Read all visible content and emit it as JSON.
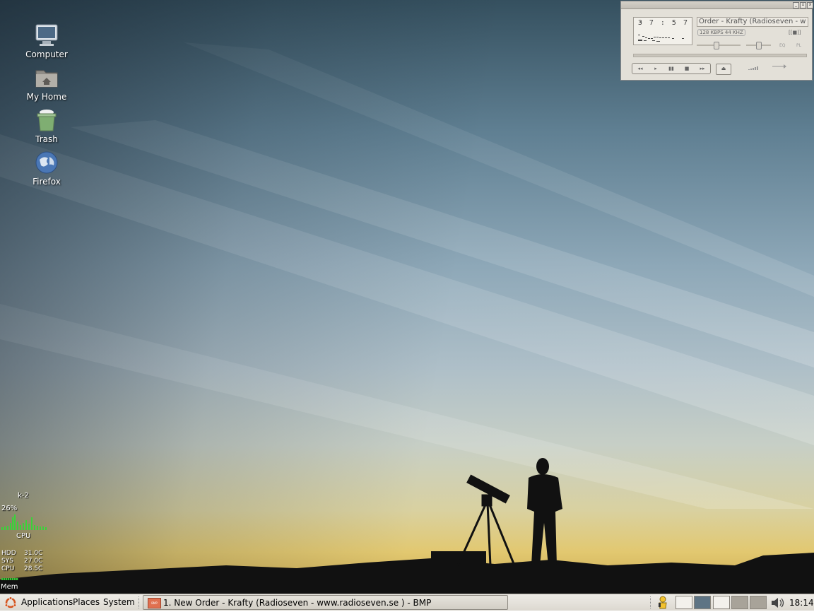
{
  "desktop": {
    "icons": [
      {
        "label": "Computer",
        "icon": "computer-icon"
      },
      {
        "label": "My Home",
        "icon": "home-folder-icon"
      },
      {
        "label": "Trash",
        "icon": "trash-icon"
      },
      {
        "label": "Firefox",
        "icon": "firefox-icon"
      }
    ]
  },
  "player": {
    "app": "BMP",
    "time": "3 7 : 5 7",
    "song_title": "Order - Krafty  (Radioseven - w",
    "bitrate": "128 KBPS",
    "samplerate": "44 KHZ",
    "mode": "[[■]]",
    "eq_label": "EQ",
    "pl_label": "PL",
    "controls": [
      "◂◂",
      "▸",
      "▮▮",
      "■",
      "▸▸"
    ],
    "eject": "⏏",
    "shuffle_icon": "shuffle-icon",
    "repeat_icon": "repeat-icon"
  },
  "sysmon": {
    "host": "k-2",
    "cpu_percent": "26%",
    "cpu_label": "CPU",
    "temps": [
      {
        "name": "HDD",
        "value": "31.0C"
      },
      {
        "name": "SYS",
        "value": "27.0C"
      },
      {
        "name": "CPU",
        "value": "28.5C"
      }
    ],
    "mem_label": "Mem"
  },
  "panel": {
    "menus": [
      "Applications",
      "Places",
      "System"
    ],
    "task": "1. New Order - Krafty  (Radioseven - www.radioseven.se  ) - BMP",
    "clock": "18:14",
    "volume_icon": "volume-icon",
    "notify_icon": "gaim-icon"
  }
}
